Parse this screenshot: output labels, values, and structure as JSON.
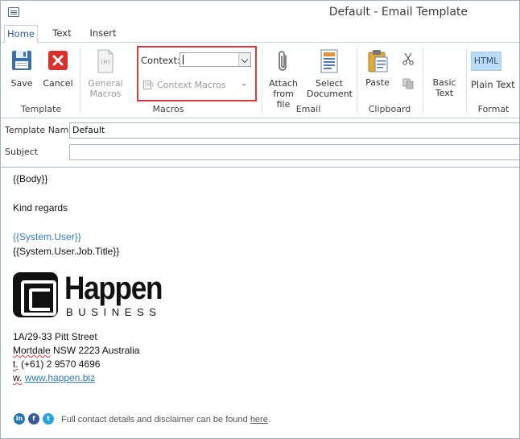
{
  "window": {
    "title": "Default - Email Template"
  },
  "tabs": [
    {
      "label": "Home",
      "active": true
    },
    {
      "label": "Text",
      "active": false
    },
    {
      "label": "Insert",
      "active": false
    }
  ],
  "ribbon": {
    "template": {
      "group_label": "Template",
      "save_label": "Save",
      "cancel_label": "Cancel"
    },
    "macros": {
      "group_label": "Macros",
      "general_macros_line1": "General",
      "general_macros_line2": "Macros",
      "context_label": "Context:",
      "context_value": "",
      "context_macros_label": "Context Macros",
      "context_macros_icon_text": "{M}"
    },
    "email": {
      "group_label": "Email",
      "attach_line1": "Attach",
      "attach_line2": "from file",
      "select_line1": "Select",
      "select_line2": "Document"
    },
    "clipboard": {
      "group_label": "Clipboard",
      "paste_label": "Paste"
    },
    "text": {
      "basic_text_line1": "Basic",
      "basic_text_line2": "Text"
    },
    "format": {
      "group_label": "Format",
      "html_label": "HTML",
      "plain_text_label": "Plain Text"
    }
  },
  "fields": {
    "template_name_label": "Template Name",
    "template_name_value": "Default",
    "subject_label": "Subject",
    "subject_value": ""
  },
  "body": {
    "body_placeholder": "{{Body}}",
    "closing": "Kind regards",
    "user_token": "{{System.User}}",
    "job_title_token": "{{System.User.Job.Title}}",
    "logo_word": "Happen",
    "logo_sub": "BUSINESS",
    "address_line1": "1A/29-33 Pitt Street",
    "address_line2_a": "Mortdale",
    "address_line2_b": " NSW 2223 Australia",
    "phone_prefix": "t.",
    "phone": " (+61) 2 9570 4696",
    "web_prefix": "w.",
    "web_link": "www.happen.biz",
    "footer_text": "Full contact details and disclaimer can be found ",
    "footer_link": "here",
    "footer_end": "."
  },
  "colors": {
    "accent": "#2a5d9f",
    "highlight_box": "#e2383a",
    "link": "#2f7bbf",
    "linkedin": "#1f77b4",
    "facebook": "#3b5998",
    "twitter": "#2aa3e0"
  },
  "icons": {
    "save": "floppy-disk-icon",
    "cancel": "red-x-icon",
    "general_macros": "macro-document-icon",
    "attach": "paperclip-icon",
    "select_document": "document-icon",
    "paste": "clipboard-icon",
    "cut": "scissors-icon",
    "copy": "copy-icon",
    "social": [
      "linkedin-icon",
      "facebook-icon",
      "twitter-icon"
    ]
  }
}
